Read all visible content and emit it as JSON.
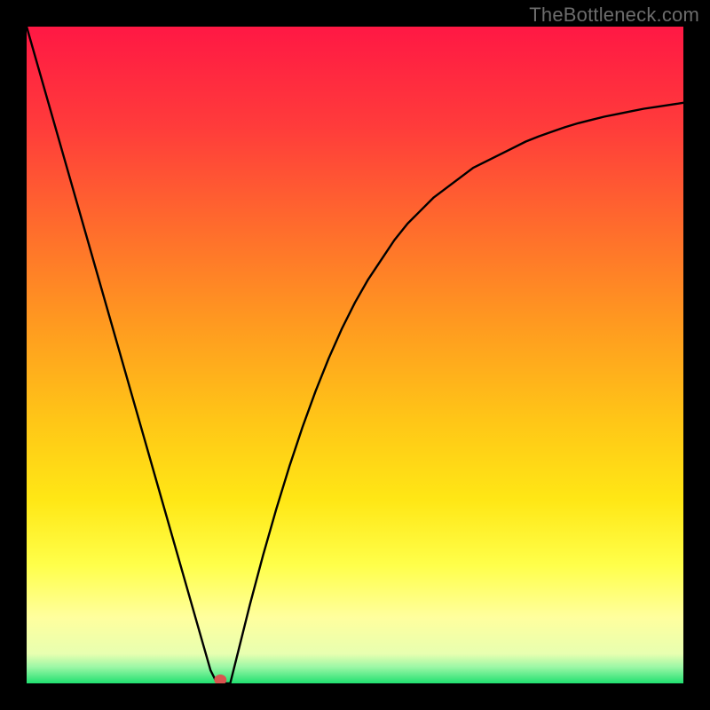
{
  "watermark": "TheBottleneck.com",
  "chart_data": {
    "type": "line",
    "title": "",
    "xlabel": "",
    "ylabel": "",
    "xlim": [
      0,
      100
    ],
    "ylim": [
      0,
      100
    ],
    "series": [
      {
        "name": "curve",
        "x": [
          0,
          2,
          4,
          6,
          8,
          10,
          12,
          14,
          16,
          18,
          20,
          22,
          24,
          26,
          27,
          28,
          29,
          30,
          31,
          32,
          33,
          34,
          36,
          38,
          40,
          42,
          44,
          46,
          48,
          50,
          52,
          54,
          56,
          58,
          60,
          62,
          64,
          66,
          68,
          70,
          72,
          74,
          76,
          78,
          80,
          82,
          84,
          86,
          88,
          90,
          92,
          94,
          96,
          98,
          100
        ],
        "y": [
          100,
          93.0,
          86.0,
          79.0,
          72.0,
          65.0,
          58.0,
          51.0,
          44.0,
          37.0,
          30.0,
          23.0,
          16.0,
          9.0,
          5.5,
          2.0,
          0.0,
          0.0,
          0.0,
          4.0,
          8.0,
          12.0,
          19.5,
          26.5,
          33.0,
          39.0,
          44.5,
          49.5,
          54.0,
          58.0,
          61.5,
          64.5,
          67.5,
          70.0,
          72.0,
          74.0,
          75.5,
          77.0,
          78.5,
          79.5,
          80.5,
          81.5,
          82.5,
          83.3,
          84.0,
          84.7,
          85.3,
          85.8,
          86.3,
          86.7,
          87.1,
          87.5,
          87.8,
          88.1,
          88.4
        ]
      }
    ],
    "marker": {
      "x": 29.5,
      "y": 0,
      "color": "#d9544f"
    },
    "background_gradient": {
      "stops": [
        {
          "offset": 0.0,
          "color": "#ff1844"
        },
        {
          "offset": 0.15,
          "color": "#ff3b3b"
        },
        {
          "offset": 0.3,
          "color": "#ff6a2d"
        },
        {
          "offset": 0.45,
          "color": "#ff9920"
        },
        {
          "offset": 0.6,
          "color": "#ffc617"
        },
        {
          "offset": 0.72,
          "color": "#ffe715"
        },
        {
          "offset": 0.82,
          "color": "#ffff4a"
        },
        {
          "offset": 0.9,
          "color": "#ffff9e"
        },
        {
          "offset": 0.955,
          "color": "#e8ffb0"
        },
        {
          "offset": 0.975,
          "color": "#9cf7a6"
        },
        {
          "offset": 1.0,
          "color": "#20e070"
        }
      ]
    }
  }
}
